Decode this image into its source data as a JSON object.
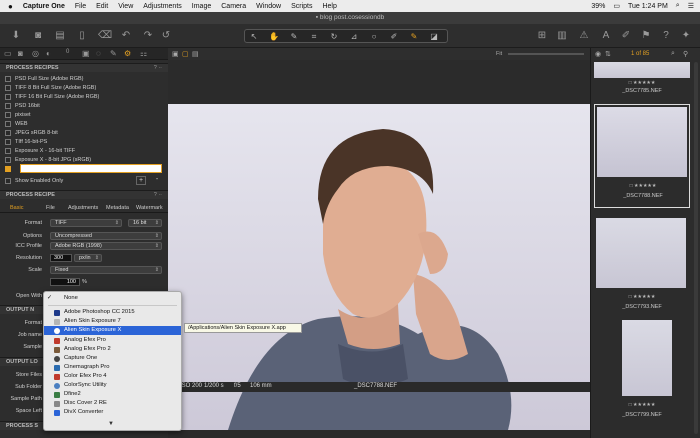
{
  "menubar": {
    "apple": "",
    "app": "Capture One",
    "items": [
      "File",
      "Edit",
      "View",
      "Adjustments",
      "Image",
      "Camera",
      "Window",
      "Scripts",
      "Help"
    ],
    "battery": "39%",
    "clock": "Tue 1:24 PM"
  },
  "window": {
    "title": "blog post.cosessiondb"
  },
  "left_panel": {
    "tab_count": "0",
    "recipes_title": "PROCESS RECIPES",
    "recipes": [
      "PSD Full Size (Adobe RGB)",
      "TIFF 8 Bit Full Size (Adobe RGB)",
      "TIFF 16 Bit Full Size (Adobe RGB)",
      "PSD 16bit",
      "pixiset",
      "WEB",
      "JPEG sRGB 8-bit",
      "TIff 16-bit-PS",
      "Exposure X - 16-bit TIFF",
      "Exposure X - 8-bit JPG (sRGB)"
    ],
    "show_enabled": "Show Enabled Only",
    "add": "+",
    "remove": "-",
    "recipe_title": "PROCESS RECIPE",
    "subtabs": [
      "Basic",
      "File",
      "Adjustments",
      "Metadata",
      "Watermark"
    ],
    "format_label": "Format",
    "format_value": "TIFF",
    "bit_value": "16 bit",
    "options_label": "Options",
    "options_value": "Uncompressed",
    "icc_label": "ICC Profile",
    "icc_value": "Adobe RGB (1998)",
    "resolution_label": "Resolution",
    "resolution_value": "300",
    "resolution_unit": "px/in",
    "scale_label": "Scale",
    "scale_value": "Fixed",
    "percent_value": "100",
    "percent_unit": "%",
    "open_with_label": "Open With",
    "output_naming_head": "OUTPUT N",
    "format2_label": "Format",
    "job_name_label": "Job name",
    "sample_label": "Sample",
    "output_location_head": "OUTPUT LO",
    "store_files_label": "Store Files",
    "sub_folder_label": "Sub Folder",
    "sample_path_label": "Sample Path",
    "space_left_label": "Space Left",
    "process_summary_head": "PROCESS S"
  },
  "dropdown": {
    "none": "None",
    "items": [
      {
        "label": "Adobe Photoshop CC 2015",
        "color": "#1e3a8a"
      },
      {
        "label": "Alien Skin Exposure 7",
        "color": "#b5b5b5"
      },
      {
        "label": "Alien Skin Exposure X",
        "color": "#ffffff"
      },
      {
        "label": "Analog Efex Pro",
        "color": "#c0392b"
      },
      {
        "label": "Analog Efex Pro 2",
        "color": "#7a5a3a"
      },
      {
        "label": "Capture One",
        "color": "#444444"
      },
      {
        "label": "Cinemagraph Pro",
        "color": "#2b6cb0"
      },
      {
        "label": "Color Efex Pro 4",
        "color": "#c0392b"
      },
      {
        "label": "ColorSync Utility",
        "color": "#4a7fc1"
      },
      {
        "label": "Dfine2",
        "color": "#3a7d44"
      },
      {
        "label": "Disc Cover 2 RE",
        "color": "#888888"
      },
      {
        "label": "DivX Converter",
        "color": "#2b64d7"
      }
    ],
    "tooltip": "/Applications/Alien Skin Exposure X.app"
  },
  "viewer": {
    "fit": "Fit",
    "iso": "ISO 200",
    "shutter": "1/200 s",
    "aperture": "f/5",
    "focal": "106 mm",
    "filename": "_DSC7788.NEF"
  },
  "right_panel": {
    "counter": "1 of 85",
    "thumbs": [
      {
        "name": "_DSC7785.NEF"
      },
      {
        "name": "_DSC7788.NEF"
      },
      {
        "name": "_DSC7793.NEF"
      },
      {
        "name": "_DSC7799.NEF"
      }
    ]
  },
  "colors": {
    "accent": "#e3a022",
    "selection": "#2b64d7"
  }
}
